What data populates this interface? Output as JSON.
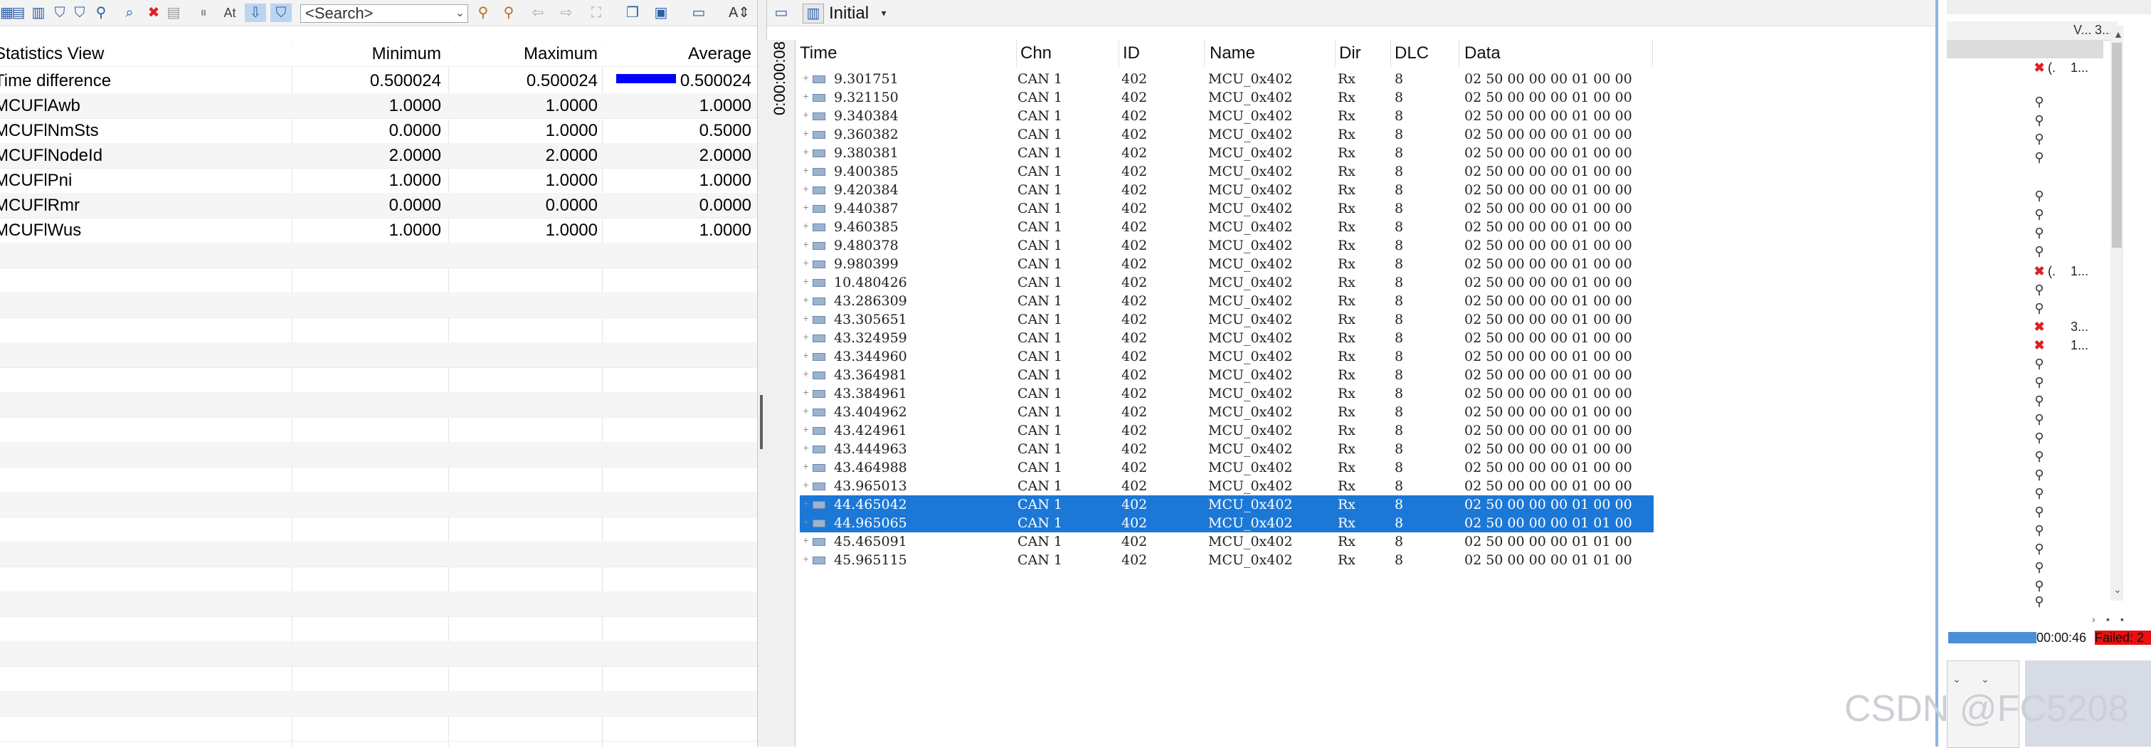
{
  "toolbar": {
    "search_placeholder": "<Search>",
    "view_selector_label": "Initial"
  },
  "stats": {
    "title": "Statistics View",
    "headers": [
      "Minimum",
      "Maximum",
      "Average"
    ],
    "rows": [
      {
        "name": "Time difference",
        "min": "0.500024",
        "max": "0.500024",
        "avg": "0.500024"
      },
      {
        "name": "MCUFlAwb",
        "min": "1.0000",
        "max": "1.0000",
        "avg": "1.0000"
      },
      {
        "name": "MCUFlNmSts",
        "min": "0.0000",
        "max": "1.0000",
        "avg": "0.5000"
      },
      {
        "name": "MCUFlNodeId",
        "min": "2.0000",
        "max": "2.0000",
        "avg": "2.0000"
      },
      {
        "name": "MCUFlPni",
        "min": "1.0000",
        "max": "1.0000",
        "avg": "1.0000"
      },
      {
        "name": "MCUFlRmr",
        "min": "0.0000",
        "max": "0.0000",
        "avg": "0.0000"
      },
      {
        "name": "MCUFlWus",
        "min": "1.0000",
        "max": "1.0000",
        "avg": "1.0000"
      }
    ]
  },
  "trace": {
    "side_time": "0:00:00:08",
    "headers": [
      "Time",
      "Chn",
      "ID",
      "Name",
      "Dir",
      "DLC",
      "Data"
    ],
    "rows": [
      {
        "time": "9.301751",
        "chn": "CAN 1",
        "id": "402",
        "name": "MCU_0x402",
        "dir": "Rx",
        "dlc": "8",
        "data": "02 50 00 00 00 01 00 00"
      },
      {
        "time": "9.321150",
        "chn": "CAN 1",
        "id": "402",
        "name": "MCU_0x402",
        "dir": "Rx",
        "dlc": "8",
        "data": "02 50 00 00 00 01 00 00"
      },
      {
        "time": "9.340384",
        "chn": "CAN 1",
        "id": "402",
        "name": "MCU_0x402",
        "dir": "Rx",
        "dlc": "8",
        "data": "02 50 00 00 00 01 00 00"
      },
      {
        "time": "9.360382",
        "chn": "CAN 1",
        "id": "402",
        "name": "MCU_0x402",
        "dir": "Rx",
        "dlc": "8",
        "data": "02 50 00 00 00 01 00 00"
      },
      {
        "time": "9.380381",
        "chn": "CAN 1",
        "id": "402",
        "name": "MCU_0x402",
        "dir": "Rx",
        "dlc": "8",
        "data": "02 50 00 00 00 01 00 00"
      },
      {
        "time": "9.400385",
        "chn": "CAN 1",
        "id": "402",
        "name": "MCU_0x402",
        "dir": "Rx",
        "dlc": "8",
        "data": "02 50 00 00 00 01 00 00"
      },
      {
        "time": "9.420384",
        "chn": "CAN 1",
        "id": "402",
        "name": "MCU_0x402",
        "dir": "Rx",
        "dlc": "8",
        "data": "02 50 00 00 00 01 00 00"
      },
      {
        "time": "9.440387",
        "chn": "CAN 1",
        "id": "402",
        "name": "MCU_0x402",
        "dir": "Rx",
        "dlc": "8",
        "data": "02 50 00 00 00 01 00 00"
      },
      {
        "time": "9.460385",
        "chn": "CAN 1",
        "id": "402",
        "name": "MCU_0x402",
        "dir": "Rx",
        "dlc": "8",
        "data": "02 50 00 00 00 01 00 00"
      },
      {
        "time": "9.480378",
        "chn": "CAN 1",
        "id": "402",
        "name": "MCU_0x402",
        "dir": "Rx",
        "dlc": "8",
        "data": "02 50 00 00 00 01 00 00"
      },
      {
        "time": "9.980399",
        "chn": "CAN 1",
        "id": "402",
        "name": "MCU_0x402",
        "dir": "Rx",
        "dlc": "8",
        "data": "02 50 00 00 00 01 00 00"
      },
      {
        "time": "10.480426",
        "chn": "CAN 1",
        "id": "402",
        "name": "MCU_0x402",
        "dir": "Rx",
        "dlc": "8",
        "data": "02 50 00 00 00 01 00 00"
      },
      {
        "time": "43.286309",
        "chn": "CAN 1",
        "id": "402",
        "name": "MCU_0x402",
        "dir": "Rx",
        "dlc": "8",
        "data": "02 50 00 00 00 01 00 00"
      },
      {
        "time": "43.305651",
        "chn": "CAN 1",
        "id": "402",
        "name": "MCU_0x402",
        "dir": "Rx",
        "dlc": "8",
        "data": "02 50 00 00 00 01 00 00"
      },
      {
        "time": "43.324959",
        "chn": "CAN 1",
        "id": "402",
        "name": "MCU_0x402",
        "dir": "Rx",
        "dlc": "8",
        "data": "02 50 00 00 00 01 00 00"
      },
      {
        "time": "43.344960",
        "chn": "CAN 1",
        "id": "402",
        "name": "MCU_0x402",
        "dir": "Rx",
        "dlc": "8",
        "data": "02 50 00 00 00 01 00 00"
      },
      {
        "time": "43.364981",
        "chn": "CAN 1",
        "id": "402",
        "name": "MCU_0x402",
        "dir": "Rx",
        "dlc": "8",
        "data": "02 50 00 00 00 01 00 00"
      },
      {
        "time": "43.384961",
        "chn": "CAN 1",
        "id": "402",
        "name": "MCU_0x402",
        "dir": "Rx",
        "dlc": "8",
        "data": "02 50 00 00 00 01 00 00"
      },
      {
        "time": "43.404962",
        "chn": "CAN 1",
        "id": "402",
        "name": "MCU_0x402",
        "dir": "Rx",
        "dlc": "8",
        "data": "02 50 00 00 00 01 00 00"
      },
      {
        "time": "43.424961",
        "chn": "CAN 1",
        "id": "402",
        "name": "MCU_0x402",
        "dir": "Rx",
        "dlc": "8",
        "data": "02 50 00 00 00 01 00 00"
      },
      {
        "time": "43.444963",
        "chn": "CAN 1",
        "id": "402",
        "name": "MCU_0x402",
        "dir": "Rx",
        "dlc": "8",
        "data": "02 50 00 00 00 01 00 00"
      },
      {
        "time": "43.464988",
        "chn": "CAN 1",
        "id": "402",
        "name": "MCU_0x402",
        "dir": "Rx",
        "dlc": "8",
        "data": "02 50 00 00 00 01 00 00"
      },
      {
        "time": "43.965013",
        "chn": "CAN 1",
        "id": "402",
        "name": "MCU_0x402",
        "dir": "Rx",
        "dlc": "8",
        "data": "02 50 00 00 00 01 00 00"
      },
      {
        "time": "44.465042",
        "chn": "CAN 1",
        "id": "402",
        "name": "MCU_0x402",
        "dir": "Rx",
        "dlc": "8",
        "data": "02 50 00 00 00 01 00 00",
        "selected": true
      },
      {
        "time": "44.965065",
        "chn": "CAN 1",
        "id": "402",
        "name": "MCU_0x402",
        "dir": "Rx",
        "dlc": "8",
        "data": "02 50 00 00 00 01 01 00",
        "selected": true
      },
      {
        "time": "45.465091",
        "chn": "CAN 1",
        "id": "402",
        "name": "MCU_0x402",
        "dir": "Rx",
        "dlc": "8",
        "data": "02 50 00 00 00 01 01 00"
      },
      {
        "time": "45.965115",
        "chn": "CAN 1",
        "id": "402",
        "name": "MCU_0x402",
        "dir": "Rx",
        "dlc": "8",
        "data": "02 50 00 00 00 01 01 00"
      }
    ]
  },
  "right_panel": {
    "col_a": "V...",
    "col_b": "3...",
    "texts": [
      "(.",
      "1...",
      "(.",
      "1...",
      "3...",
      "1..."
    ],
    "status_time": "00:00:46",
    "status_failed": "Failed: 2"
  },
  "watermark": "CSDN @FC5208",
  "colors": {
    "selection": "#1b78d6",
    "average_bar": "#0000ff",
    "failed": "#e81010"
  },
  "stats_average_fraction": 1.0
}
